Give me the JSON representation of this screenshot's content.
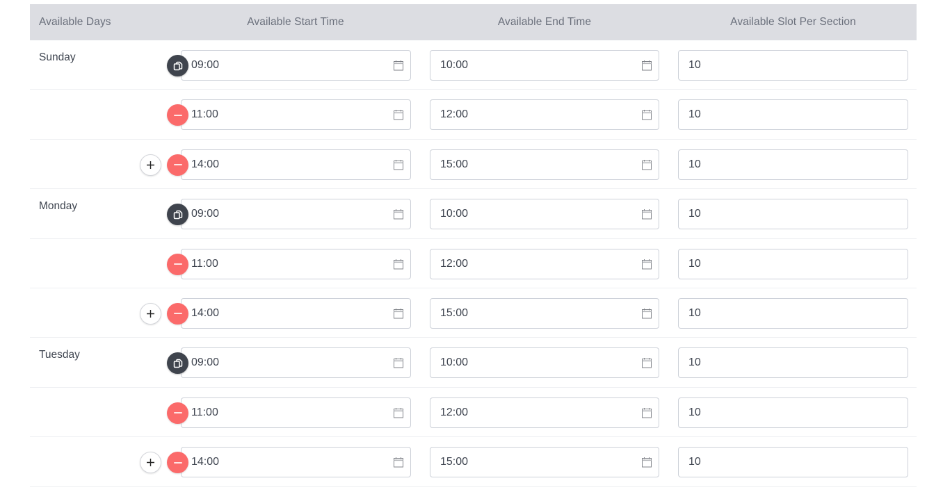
{
  "table": {
    "headers": {
      "days": "Available Days",
      "start": "Available Start Time",
      "end": "Available End Time",
      "slot": "Available Slot Per Section"
    },
    "colors": {
      "header_bg": "#dcdde2",
      "copy_button": "#3f444d",
      "remove_button": "#fb6a6a"
    },
    "days": [
      {
        "day": "Sunday",
        "slots": [
          {
            "start": "09:00",
            "end": "10:00",
            "slot": "10",
            "action": "copy"
          },
          {
            "start": "11:00",
            "end": "12:00",
            "slot": "10",
            "action": "remove"
          },
          {
            "start": "14:00",
            "end": "15:00",
            "slot": "10",
            "action": "remove",
            "add": true
          }
        ]
      },
      {
        "day": "Monday",
        "slots": [
          {
            "start": "09:00",
            "end": "10:00",
            "slot": "10",
            "action": "copy"
          },
          {
            "start": "11:00",
            "end": "12:00",
            "slot": "10",
            "action": "remove"
          },
          {
            "start": "14:00",
            "end": "15:00",
            "slot": "10",
            "action": "remove",
            "add": true
          }
        ]
      },
      {
        "day": "Tuesday",
        "slots": [
          {
            "start": "09:00",
            "end": "10:00",
            "slot": "10",
            "action": "copy"
          },
          {
            "start": "11:00",
            "end": "12:00",
            "slot": "10",
            "action": "remove"
          },
          {
            "start": "14:00",
            "end": "15:00",
            "slot": "10",
            "action": "remove",
            "add": true
          }
        ]
      }
    ]
  }
}
